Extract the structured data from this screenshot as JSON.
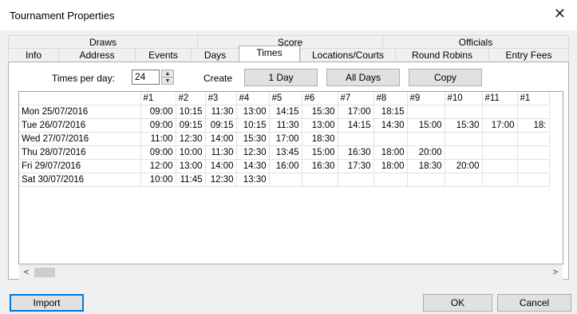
{
  "window": {
    "title": "Tournament Properties",
    "close_glyph": "✕"
  },
  "tabs_row1": [
    "Draws",
    "Score",
    "Officials"
  ],
  "tabs_row2": [
    "Info",
    "Address",
    "Events",
    "Days",
    "Times",
    "Locations/Courts",
    "Round Robins",
    "Entry Fees"
  ],
  "active_tab": "Times",
  "controls": {
    "times_per_day_label": "Times per day:",
    "times_per_day_value": "24",
    "spin_up": "▲",
    "spin_down": "▼",
    "create_label": "Create",
    "one_day_button": "1 Day",
    "all_days_button": "All Days",
    "copy_button": "Copy"
  },
  "table": {
    "columns": [
      "",
      "#1",
      "#2",
      "#3",
      "#4",
      "#5",
      "#6",
      "#7",
      "#8",
      "#9",
      "#10",
      "#11",
      "#1"
    ],
    "rows": [
      {
        "day": "Mon 25/07/2016",
        "times": [
          "09:00",
          "10:15",
          "11:30",
          "13:00",
          "14:15",
          "15:30",
          "17:00",
          "18:15",
          "",
          "",
          "",
          ""
        ]
      },
      {
        "day": "Tue 26/07/2016",
        "times": [
          "09:00",
          "09:15",
          "09:15",
          "10:15",
          "11:30",
          "13:00",
          "14:15",
          "14:30",
          "15:00",
          "15:30",
          "17:00",
          "18:"
        ]
      },
      {
        "day": "Wed 27/07/2016",
        "times": [
          "11:00",
          "12:30",
          "14:00",
          "15:30",
          "17:00",
          "18:30",
          "",
          "",
          "",
          "",
          "",
          ""
        ]
      },
      {
        "day": "Thu 28/07/2016",
        "times": [
          "09:00",
          "10:00",
          "11:30",
          "12:30",
          "13:45",
          "15:00",
          "16:30",
          "18:00",
          "20:00",
          "",
          "",
          ""
        ]
      },
      {
        "day": "Fri 29/07/2016",
        "times": [
          "12:00",
          "13:00",
          "14:00",
          "14:30",
          "16:00",
          "16:30",
          "17:30",
          "18:00",
          "18:30",
          "20:00",
          "",
          ""
        ]
      },
      {
        "day": "Sat 30/07/2016",
        "times": [
          "10:00",
          "11:45",
          "12:30",
          "13:30",
          "",
          "",
          "",
          "",
          "",
          "",
          "",
          ""
        ]
      }
    ]
  },
  "scrollbar": {
    "left_arrow": "<",
    "right_arrow": ">"
  },
  "footer": {
    "import_button": "Import",
    "ok_button": "OK",
    "cancel_button": "Cancel"
  }
}
